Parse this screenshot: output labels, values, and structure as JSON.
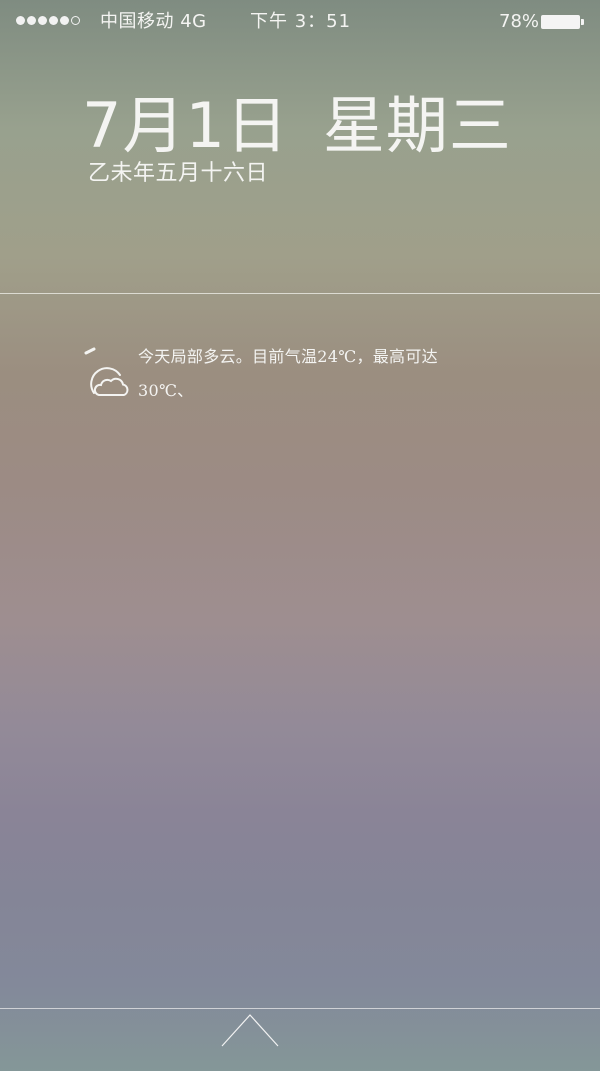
{
  "status_bar": {
    "signal_bars_filled": 5,
    "signal_bars_total": 6,
    "carrier": "中国移动  4G",
    "time": "下午 3：51",
    "battery_percent": "78%",
    "battery_level": 1.0
  },
  "lock_screen": {
    "date": "7月1日",
    "weekday": "星期三",
    "lunar_date": "乙未年五月十六日"
  },
  "weather": {
    "icon": "partly-cloudy-icon",
    "line1": "今天局部多云。目前气温24℃，最高可达",
    "line2": "30℃、"
  },
  "bottom": {
    "icon": "chevron-up-icon"
  },
  "colors": {
    "text": "#f4f4f2",
    "background_top": "#7f8c81",
    "background_mid": "#9c8b84",
    "background_bottom": "#849798"
  }
}
